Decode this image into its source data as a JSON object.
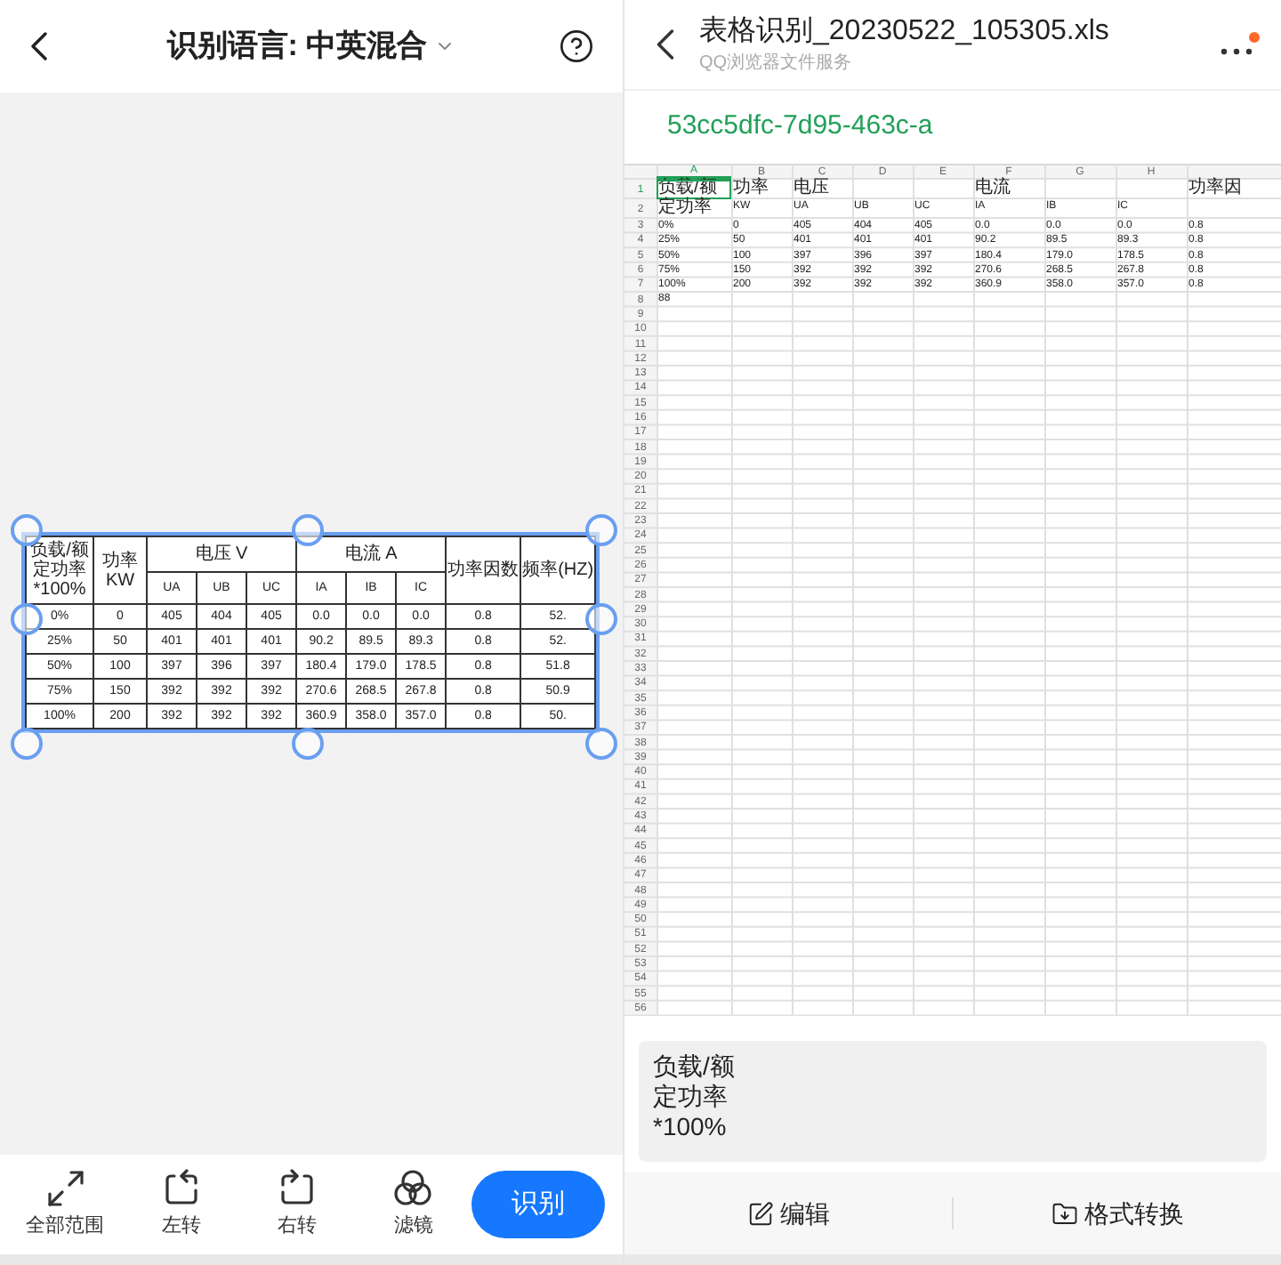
{
  "left": {
    "title": "识别语言: 中英混合",
    "scan": {
      "corner_header": "负载/额定功率*100%",
      "power_header": "功率 KW",
      "groups": [
        {
          "title": "电压  V",
          "columns": [
            "UA",
            "UB",
            "UC"
          ]
        },
        {
          "title": "电流  A",
          "columns": [
            "IA",
            "IB",
            "IC"
          ]
        }
      ],
      "pf_header": "功率因数",
      "freq_header": "频率(HZ)",
      "rows": [
        [
          "0%",
          "0",
          "405",
          "404",
          "405",
          "0.0",
          "0.0",
          "0.0",
          "0.8",
          "52."
        ],
        [
          "25%",
          "50",
          "401",
          "401",
          "401",
          "90.2",
          "89.5",
          "89.3",
          "0.8",
          "52."
        ],
        [
          "50%",
          "100",
          "397",
          "396",
          "397",
          "180.4",
          "179.0",
          "178.5",
          "0.8",
          "51.8"
        ],
        [
          "75%",
          "150",
          "392",
          "392",
          "392",
          "270.6",
          "268.5",
          "267.8",
          "0.8",
          "50.9"
        ],
        [
          "100%",
          "200",
          "392",
          "392",
          "392",
          "360.9",
          "358.0",
          "357.0",
          "0.8",
          "50."
        ]
      ]
    },
    "tools": [
      {
        "kind": "expand",
        "label": "全部范围"
      },
      {
        "kind": "rotate-left",
        "label": "左转"
      },
      {
        "kind": "rotate-right",
        "label": "右转"
      },
      {
        "kind": "filter",
        "label": "滤镜"
      }
    ],
    "action": "识别"
  },
  "right": {
    "title": "表格识别_20230522_105305.xls",
    "subtitle": "QQ浏览器文件服务",
    "notification": true,
    "sheet_name": "53cc5dfc-7d95-463c-a",
    "columns": [
      {
        "label": "A",
        "selected": true
      },
      {
        "label": "B",
        "selected": false
      },
      {
        "label": "C",
        "selected": false
      },
      {
        "label": "D",
        "selected": false
      },
      {
        "label": "E",
        "selected": false
      },
      {
        "label": "F",
        "selected": false
      },
      {
        "label": "G",
        "selected": false
      },
      {
        "label": "H",
        "selected": false
      }
    ],
    "rows": [
      {
        "number": "1",
        "selected": true,
        "cells": [
          "负载/额",
          "功率",
          "电压",
          null,
          null,
          "电流",
          null,
          null,
          "功率因"
        ]
      },
      {
        "number": "2",
        "selected": false,
        "cells": [
          "定功率",
          "KW",
          "UA",
          "UB",
          "UC",
          "IA",
          "IB",
          "IC",
          null
        ]
      },
      {
        "number": "3",
        "selected": false,
        "cells": [
          "0%",
          "0",
          "405",
          "404",
          "405",
          "0.0",
          "0.0",
          "0.0",
          "0.8"
        ]
      },
      {
        "number": "4",
        "selected": false,
        "cells": [
          "25%",
          "50",
          "401",
          "401",
          "401",
          "90.2",
          "89.5",
          "89.3",
          "0.8"
        ]
      },
      {
        "number": "5",
        "selected": false,
        "cells": [
          "50%",
          "100",
          "397",
          "396",
          "397",
          "180.4",
          "179.0",
          "178.5",
          "0.8"
        ]
      },
      {
        "number": "6",
        "selected": false,
        "cells": [
          "75%",
          "150",
          "392",
          "392",
          "392",
          "270.6",
          "268.5",
          "267.8",
          "0.8"
        ]
      },
      {
        "number": "7",
        "selected": false,
        "cells": [
          "100%",
          "200",
          "392",
          "392",
          "392",
          "360.9",
          "358.0",
          "357.0",
          "0.8"
        ]
      },
      {
        "number": "8",
        "selected": false,
        "cells": [
          "88"
        ]
      },
      {
        "number": "9",
        "selected": false
      },
      {
        "number": "10",
        "selected": false
      },
      {
        "number": "11",
        "selected": false
      },
      {
        "number": "12",
        "selected": false
      },
      {
        "number": "13",
        "selected": false
      },
      {
        "number": "14",
        "selected": false
      },
      {
        "number": "15",
        "selected": false
      },
      {
        "number": "16",
        "selected": false
      },
      {
        "number": "17",
        "selected": false
      },
      {
        "number": "18",
        "selected": false
      },
      {
        "number": "19",
        "selected": false
      },
      {
        "number": "20",
        "selected": false
      },
      {
        "number": "21",
        "selected": false
      },
      {
        "number": "22",
        "selected": false
      },
      {
        "number": "23",
        "selected": false
      },
      {
        "number": "24",
        "selected": false
      },
      {
        "number": "25",
        "selected": false
      },
      {
        "number": "26",
        "selected": false
      },
      {
        "number": "27",
        "selected": false
      },
      {
        "number": "28",
        "selected": false
      },
      {
        "number": "29",
        "selected": false
      },
      {
        "number": "30",
        "selected": false
      },
      {
        "number": "31",
        "selected": false
      },
      {
        "number": "32",
        "selected": false
      },
      {
        "number": "33",
        "selected": false
      },
      {
        "number": "34",
        "selected": false
      },
      {
        "number": "35",
        "selected": false
      },
      {
        "number": "36",
        "selected": false
      },
      {
        "number": "37",
        "selected": false
      },
      {
        "number": "38",
        "selected": false
      },
      {
        "number": "39",
        "selected": false
      },
      {
        "number": "40",
        "selected": false
      },
      {
        "number": "41",
        "selected": false
      },
      {
        "number": "42",
        "selected": false
      },
      {
        "number": "43",
        "selected": false
      },
      {
        "number": "44",
        "selected": false
      },
      {
        "number": "45",
        "selected": false
      },
      {
        "number": "46",
        "selected": false
      },
      {
        "number": "47",
        "selected": false
      },
      {
        "number": "48",
        "selected": false
      },
      {
        "number": "49",
        "selected": false
      },
      {
        "number": "50",
        "selected": false
      },
      {
        "number": "51",
        "selected": false
      },
      {
        "number": "52",
        "selected": false
      },
      {
        "number": "53",
        "selected": false
      },
      {
        "number": "54",
        "selected": false
      },
      {
        "number": "55",
        "selected": false
      },
      {
        "number": "56",
        "selected": false
      }
    ],
    "preview": [
      "负载/额",
      "定功率",
      "*100%"
    ],
    "buttons": [
      {
        "kind": "edit",
        "label": "编辑"
      },
      {
        "kind": "convert",
        "label": "格式转换"
      }
    ]
  }
}
